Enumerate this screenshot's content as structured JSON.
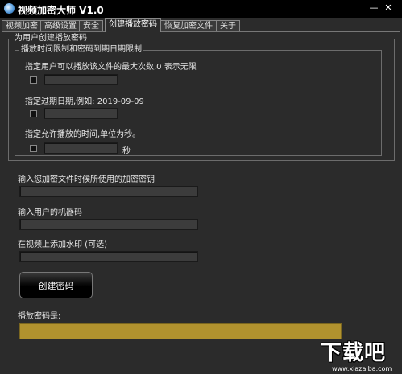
{
  "window": {
    "title": "视频加密大师 V1.0",
    "minimize_glyph": "—",
    "close_glyph": "✕"
  },
  "tabs": [
    {
      "label": "视频加密",
      "active": false
    },
    {
      "label": "高级设置",
      "active": false
    },
    {
      "label": "安全",
      "active": false
    },
    {
      "label": "创建播放密码",
      "active": true
    },
    {
      "label": "恢复加密文件",
      "active": false
    },
    {
      "label": "关于",
      "active": false
    }
  ],
  "panel": {
    "group_title": "为用户创建播放密码",
    "subgroup_title": "播放时间限制和密码到期日期限制",
    "max_plays_label": "指定用户可以播放该文件的最大次数,0 表示无限",
    "max_plays_value": "",
    "expire_label": "指定过期日期,例如: 2019-09-09",
    "expire_value": "",
    "duration_label": "指定允许播放的时间,单位为秒。",
    "duration_value": "",
    "duration_unit": "秒",
    "key_label": "输入您加密文件时候所使用的加密密钥",
    "key_value": "",
    "machine_label": "输入用户的机器码",
    "machine_value": "",
    "watermark_label": "在视频上添加水印 (可选)",
    "watermark_value": "",
    "create_button": "创建密码",
    "result_label": "播放密码是:",
    "result_value": ""
  },
  "watermark_logo": {
    "text": "下载吧",
    "url": "www.xiazaiba.com"
  },
  "colors": {
    "background": "#2b2b2b",
    "titlebar": "#000000",
    "result_box": "#b1922e"
  }
}
